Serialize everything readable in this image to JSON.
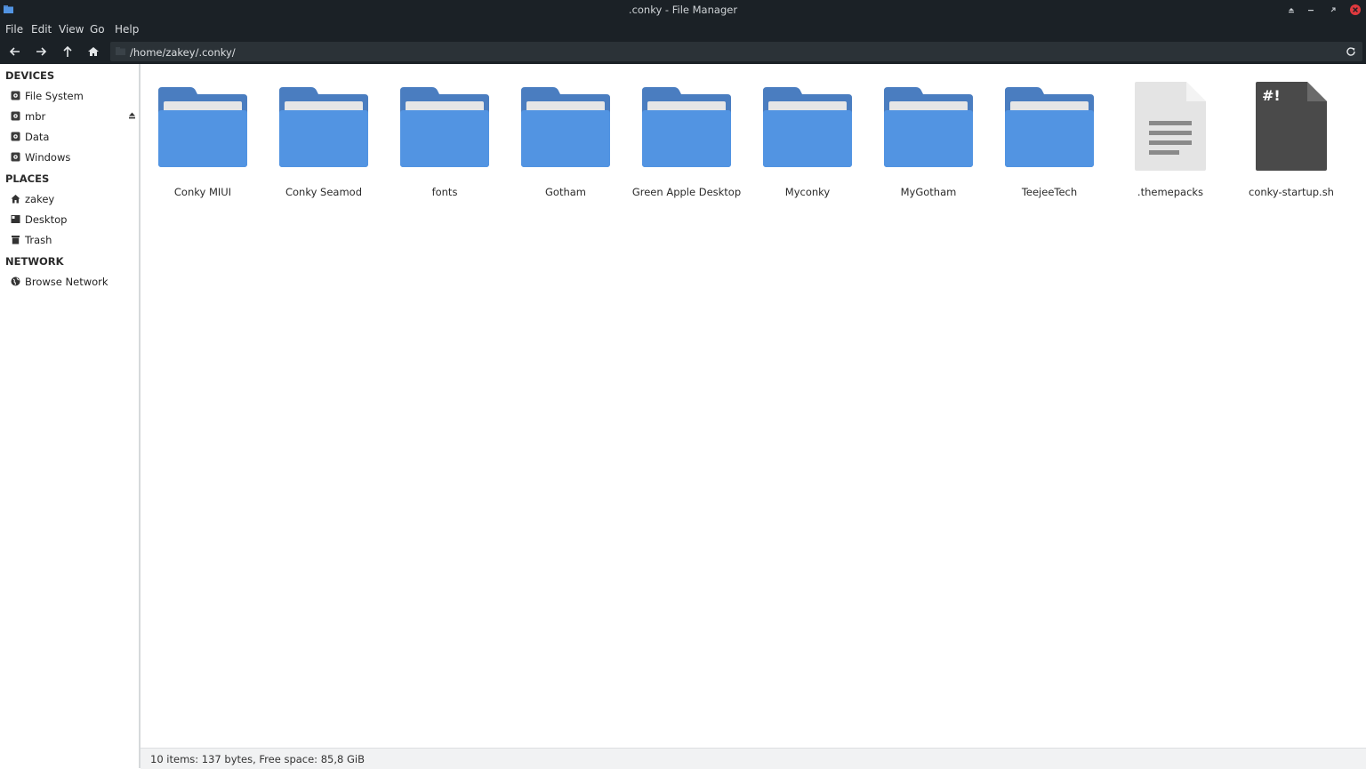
{
  "window": {
    "title": ".conky - File Manager",
    "controls": [
      "eject-icon",
      "minimize-icon",
      "restore-icon",
      "close-icon"
    ]
  },
  "menubar": {
    "items": [
      "File",
      "Edit",
      "View",
      "Go",
      "Help"
    ]
  },
  "toolbar": {
    "buttons": [
      "back-arrow-icon",
      "forward-arrow-icon",
      "up-arrow-icon",
      "home-icon"
    ],
    "path": "/home/zakey/.conky/"
  },
  "sidebar": {
    "devices_title": "DEVICES",
    "devices": [
      {
        "label": "File System",
        "icon": "drive-icon"
      },
      {
        "label": "mbr",
        "icon": "drive-icon"
      },
      {
        "label": "Data",
        "icon": "drive-icon"
      },
      {
        "label": "Windows",
        "icon": "drive-icon"
      }
    ],
    "places_title": "PLACES",
    "places": [
      {
        "label": "zakey",
        "icon": "home-icon"
      },
      {
        "label": "Desktop",
        "icon": "desktop-icon"
      },
      {
        "label": "Trash",
        "icon": "trash-icon"
      }
    ],
    "network_title": "NETWORK",
    "network": [
      {
        "label": "Browse Network",
        "icon": "network-globe-icon"
      }
    ]
  },
  "files": [
    {
      "name": "Conky MIUI",
      "type": "folder"
    },
    {
      "name": "Conky Seamod",
      "type": "folder"
    },
    {
      "name": "fonts",
      "type": "folder"
    },
    {
      "name": "Gotham",
      "type": "folder"
    },
    {
      "name": "Green Apple Desktop",
      "type": "folder"
    },
    {
      "name": "Myconky",
      "type": "folder"
    },
    {
      "name": "MyGotham",
      "type": "folder"
    },
    {
      "name": "TeejeeTech",
      "type": "folder"
    },
    {
      "name": ".themepacks",
      "type": "text-file"
    },
    {
      "name": "conky-startup.sh",
      "type": "script-file",
      "glyph": "#!"
    }
  ],
  "status": "10 items: 137 bytes, Free space: 85,8 GiB",
  "colors": {
    "chrome_bg": "#1b2126",
    "folder_front": "#5294e2",
    "folder_back": "#4a7dc0",
    "close_red": "#e0393e"
  }
}
